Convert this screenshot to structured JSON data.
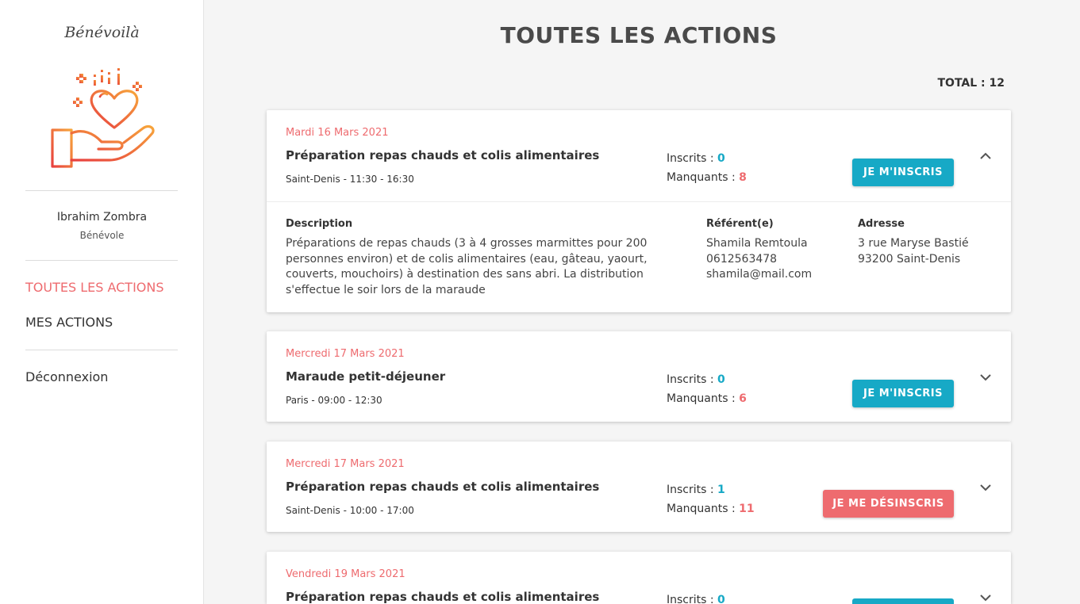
{
  "sidebar": {
    "brand": "Bénévoilà",
    "user": {
      "name": "Ibrahim Zombra",
      "role": "Bénévole"
    },
    "nav": [
      {
        "label": "TOUTES LES ACTIONS",
        "active": true
      },
      {
        "label": "MES ACTIONS",
        "active": false
      }
    ],
    "logout": "Déconnexion"
  },
  "main": {
    "title": "TOUTES LES ACTIONS",
    "total": "TOTAL : 12"
  },
  "labels": {
    "inscrits": "Inscrits : ",
    "manquants": "Manquants : ",
    "description": "Description",
    "referent": "Référent(e)",
    "adresse": "Adresse"
  },
  "actions": [
    {
      "date": "Mardi 16 Mars 2021",
      "title": "Préparation repas chauds et colis alimentaires",
      "place": "Saint-Denis - 11:30 - 16:30",
      "inscrits": "0",
      "manquants": "8",
      "button": "JE M'INSCRIS",
      "expanded": true,
      "description": [
        "Préparations de repas chauds (3 à 4 grosses marmittes pour 200",
        "personnes environ) et de colis alimentaires (eau, gâteau, yaourt,",
        "couverts, mouchoirs) à destination des sans abri. La distribution",
        "s'effectue le soir lors de la maraude"
      ],
      "referent": {
        "name": "Shamila Remtoula",
        "phone": "0612563478",
        "email": "shamila@mail.com"
      },
      "address": {
        "line1": "3 rue Maryse Bastié",
        "line2": "93200 Saint-Denis"
      }
    },
    {
      "date": "Mercredi 17 Mars 2021",
      "title": "Maraude petit-déjeuner",
      "place": "Paris - 09:00 - 12:30",
      "inscrits": "0",
      "manquants": "6",
      "button": "JE M'INSCRIS"
    },
    {
      "date": "Mercredi 17 Mars 2021",
      "title": "Préparation repas chauds et colis alimentaires",
      "place": "Saint-Denis - 10:00 - 17:00",
      "inscrits": "1",
      "manquants": "11",
      "button": "JE ME DÉSINSCRIS"
    },
    {
      "date": "Vendredi 19 Mars 2021",
      "title": "Préparation repas chauds et colis alimentaires",
      "inscrits": "0"
    }
  ],
  "colors": {
    "accent": "#ee6b6f",
    "primary": "#17a9c6"
  },
  "icons": {
    "logo": "heart-hand-logo-icon",
    "expand": "chevron-down-icon",
    "collapse": "chevron-up-icon"
  }
}
